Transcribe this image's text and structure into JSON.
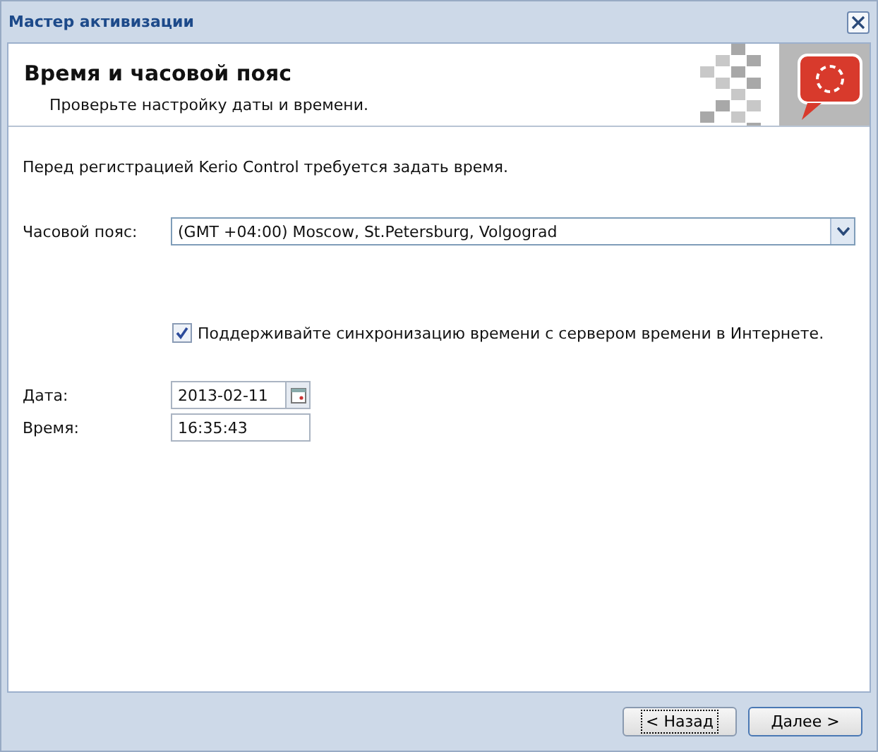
{
  "window": {
    "title": "Мастер активизации"
  },
  "header": {
    "title": "Время и часовой пояс",
    "subtitle": "Проверьте настройку даты и времени."
  },
  "intro": "Перед регистрацией Kerio Control требуется задать время.",
  "timezone": {
    "label": "Часовой пояс:",
    "value": "(GMT +04:00) Moscow, St.Petersburg, Volgograd"
  },
  "sync": {
    "label": "Поддерживайте синхронизацию времени с сервером времени в Интернете.",
    "checked": true
  },
  "date": {
    "label": "Дата:",
    "value": "2013-02-11"
  },
  "time": {
    "label": "Время:",
    "value": "16:35:43"
  },
  "buttons": [
    {
      "label": "< Назад",
      "focused": true
    },
    {
      "label": "Далее >",
      "focused": false
    }
  ]
}
